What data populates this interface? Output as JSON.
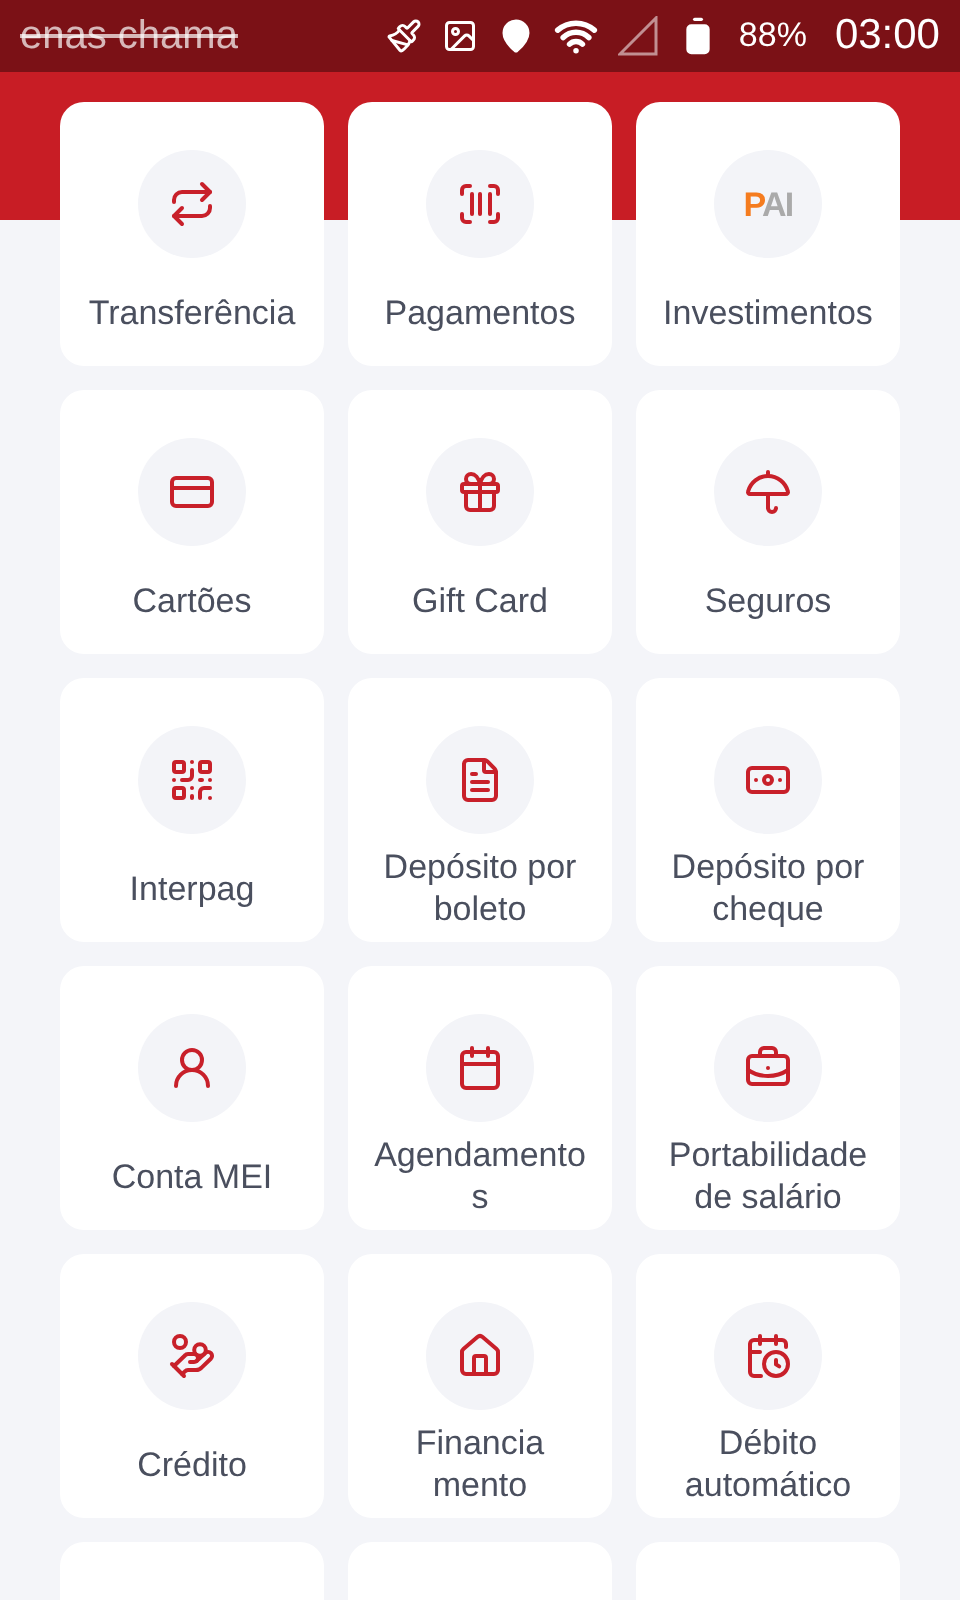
{
  "status_bar": {
    "ticker": "enas chama",
    "battery": "88%",
    "time": "03:00"
  },
  "items": [
    {
      "kind": "transfer",
      "label_lines": [
        "Transferência"
      ]
    },
    {
      "kind": "barcode",
      "label_lines": [
        "Pagamentos"
      ]
    },
    {
      "kind": "logo",
      "logo_text": "PAI",
      "label_lines": [
        "Investimentos"
      ]
    },
    {
      "kind": "card",
      "label_lines": [
        "Cartões"
      ]
    },
    {
      "kind": "gift",
      "label_lines": [
        "Gift Card"
      ]
    },
    {
      "kind": "umbrella",
      "label_lines": [
        "Seguros"
      ]
    },
    {
      "kind": "qr",
      "label_lines": [
        "Interpag"
      ]
    },
    {
      "kind": "bill",
      "label_lines": [
        "Depósito por",
        "boleto"
      ]
    },
    {
      "kind": "cheque",
      "label_lines": [
        "Depósito por",
        "cheque"
      ]
    },
    {
      "kind": "person",
      "label_lines": [
        "Conta MEI"
      ]
    },
    {
      "kind": "calendar",
      "label_lines": [
        "Agendamento",
        "s"
      ]
    },
    {
      "kind": "briefcase",
      "label_lines": [
        "Portabilidade",
        "de salário"
      ]
    },
    {
      "kind": "hand",
      "label_lines": [
        "Crédito"
      ]
    },
    {
      "kind": "house",
      "label_lines": [
        "Financia",
        "mento"
      ]
    },
    {
      "kind": "clock",
      "label_lines": [
        "Débito",
        "automático"
      ]
    },
    {
      "kind": "cut"
    },
    {
      "kind": "cut"
    },
    {
      "kind": "cut"
    }
  ]
}
